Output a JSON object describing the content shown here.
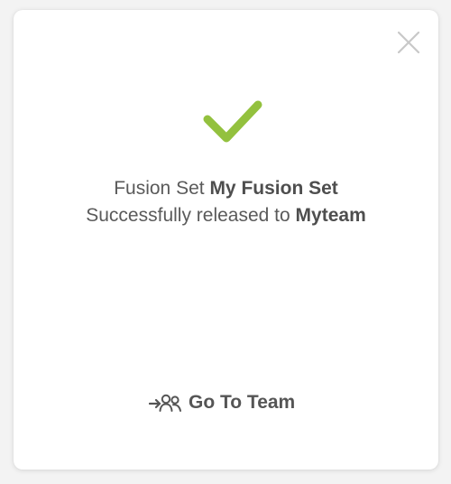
{
  "dialog": {
    "close_icon": "close-icon",
    "success_icon": "checkmark-icon",
    "line1_prefix": "Fusion Set",
    "line1_name": "My Fusion Set",
    "line2_prefix": "Successfully released to",
    "line2_team": "Myteam",
    "goto_label": "Go To Team",
    "goto_icon": "go-to-team-icon"
  },
  "colors": {
    "check": "#93c13e",
    "close": "#c8c8c8",
    "text": "#5a5a5a"
  }
}
